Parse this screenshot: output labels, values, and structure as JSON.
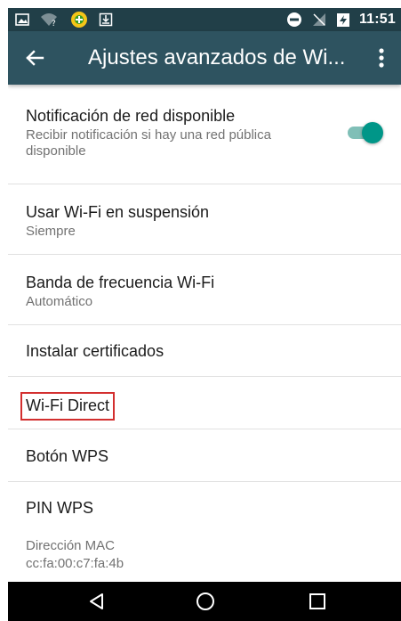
{
  "status_bar": {
    "time": "11:51",
    "icons_left": [
      "image-icon",
      "wifi-question-icon",
      "lottery-icon",
      "download-icon"
    ],
    "icons_right": [
      "do-not-disturb-icon",
      "no-signal-icon",
      "battery-charging-icon"
    ]
  },
  "app_bar": {
    "title": "Ajustes avanzados de Wi..."
  },
  "settings": {
    "network_notification": {
      "title": "Notificación de red disponible",
      "summary": "Recibir notificación si hay una red pública disponible",
      "toggle_on": true
    },
    "wifi_sleep": {
      "title": "Usar Wi-Fi en suspensión",
      "summary": "Siempre"
    },
    "frequency_band": {
      "title": "Banda de frecuencia Wi-Fi",
      "summary": "Automático"
    },
    "install_certificates": {
      "title": "Instalar certificados"
    },
    "wifi_direct": {
      "title": "Wi-Fi Direct",
      "highlighted": true
    },
    "wps_button": {
      "title": "Botón WPS"
    },
    "wps_pin": {
      "title": "PIN WPS"
    },
    "mac_address": {
      "title": "Dirección MAC",
      "value": "cc:fa:00:c7:fa:4b"
    }
  },
  "colors": {
    "status_bar": "#213f48",
    "app_bar": "#2e5360",
    "accent": "#009688",
    "highlight_border": "#d32f2f"
  }
}
